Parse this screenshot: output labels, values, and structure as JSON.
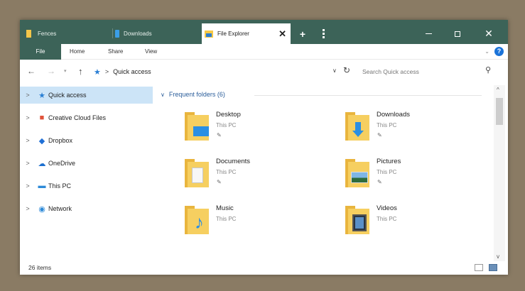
{
  "titlebar": {
    "tabs": [
      {
        "label": "Fences",
        "icon": "folder-icon"
      },
      {
        "label": "Downloads",
        "icon": "download-icon"
      },
      {
        "label": "File Explorer",
        "icon": "file-explorer-icon",
        "active": true
      }
    ],
    "close_tab_glyph": "✕",
    "new_tab_glyph": "+",
    "close_glyph": "✕"
  },
  "ribbon": {
    "tabs": [
      "File",
      "Home",
      "Share",
      "View"
    ],
    "expand_glyph": "⌄",
    "help_glyph": "?"
  },
  "addressbar": {
    "back_glyph": "←",
    "forward_glyph": "→",
    "history_glyph": "▾",
    "up_glyph": "↑",
    "location": "Quick access",
    "separator": ">",
    "dropdown_glyph": "∨",
    "refresh_glyph": "↻",
    "search_placeholder": "Search Quick access",
    "search_glyph": "⚲"
  },
  "sidebar": {
    "items": [
      {
        "label": "Quick access",
        "icon": "star-icon",
        "selected": true
      },
      {
        "label": "Creative Cloud Files",
        "icon": "creative-cloud-icon"
      },
      {
        "label": "Dropbox",
        "icon": "dropbox-icon"
      },
      {
        "label": "OneDrive",
        "icon": "cloud-icon"
      },
      {
        "label": "This PC",
        "icon": "computer-icon"
      },
      {
        "label": "Network",
        "icon": "network-icon"
      }
    ],
    "chevron": ">"
  },
  "content": {
    "group_title": "Frequent folders (6)",
    "group_chevron": "∨",
    "folders": [
      {
        "name": "Desktop",
        "location": "This PC",
        "pinned": true,
        "icon": "desktop-folder-icon"
      },
      {
        "name": "Downloads",
        "location": "This PC",
        "pinned": true,
        "icon": "downloads-folder-icon"
      },
      {
        "name": "Documents",
        "location": "This PC",
        "pinned": true,
        "icon": "documents-folder-icon"
      },
      {
        "name": "Pictures",
        "location": "This PC",
        "pinned": true,
        "icon": "pictures-folder-icon"
      },
      {
        "name": "Music",
        "location": "This PC",
        "pinned": false,
        "icon": "music-folder-icon"
      },
      {
        "name": "Videos",
        "location": "This PC",
        "pinned": false,
        "icon": "videos-folder-icon"
      }
    ],
    "pin_glyph": "✎"
  },
  "scrollbar": {
    "up_glyph": "^",
    "down_glyph": "v"
  },
  "status": {
    "item_count": "26 items"
  },
  "colors": {
    "accent": "#3c6358",
    "selection": "#cce4f7",
    "folder": "#f6cf60",
    "group_title": "#2a5d9a",
    "background": "#8a7b64"
  }
}
